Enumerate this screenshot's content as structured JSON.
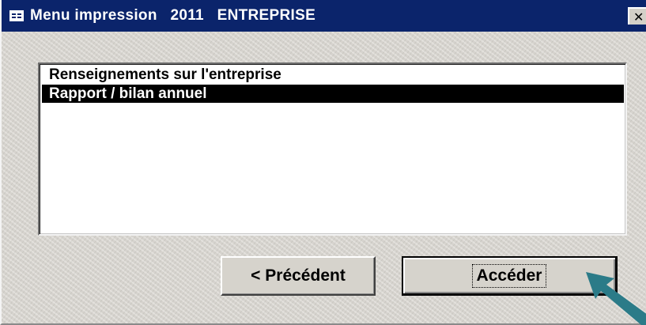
{
  "window": {
    "title": "Menu impression   2011   ENTREPRISE",
    "close_glyph": "✕",
    "title_bar_color": "#0b246b"
  },
  "list": {
    "items": [
      {
        "label": "Renseignements sur l'entreprise",
        "selected": false
      },
      {
        "label": "Rapport / bilan annuel",
        "selected": true
      }
    ]
  },
  "buttons": {
    "previous_label": "< Précédent",
    "go_label": "Accéder"
  },
  "annotation": {
    "arrow_color": "#2b7b88",
    "icon": "pointer-arrow-icon"
  }
}
